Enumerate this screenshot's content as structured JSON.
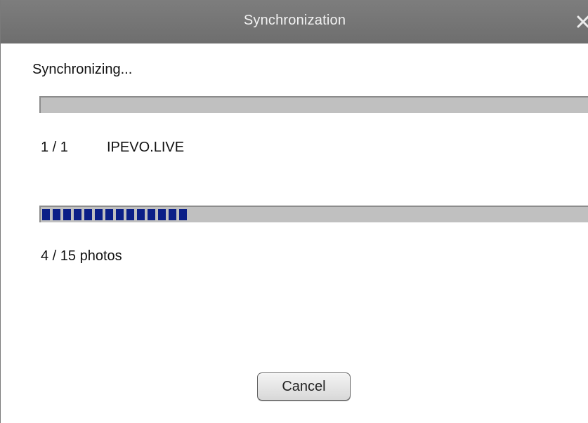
{
  "window": {
    "title": "Synchronization"
  },
  "status": {
    "text": "Synchronizing..."
  },
  "overall_progress": {
    "value": 0
  },
  "current_item": {
    "counter": "1 / 1",
    "name": "IPEVO.LIVE"
  },
  "photo_progress": {
    "value": 0.27,
    "label": "4 / 15 photos"
  },
  "buttons": {
    "cancel_label": "Cancel"
  },
  "icons": {
    "close": "close-icon"
  },
  "colors": {
    "titlebar": "#767676",
    "progress_fill": "#0b1f87",
    "progress_track": "#c0c0c0"
  }
}
